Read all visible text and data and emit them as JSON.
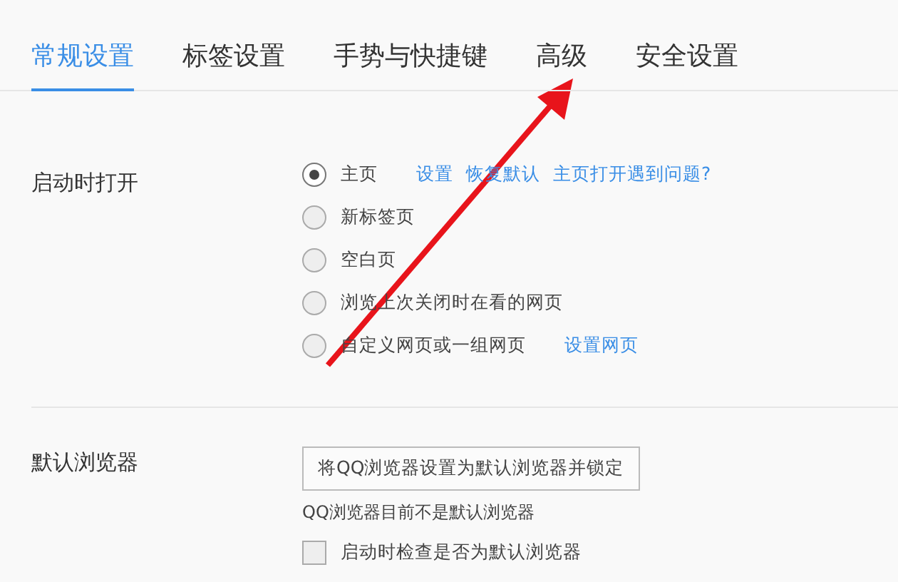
{
  "tabs": [
    {
      "label": "常规设置",
      "selected": true
    },
    {
      "label": "标签设置",
      "selected": false
    },
    {
      "label": "手势与快捷键",
      "selected": false
    },
    {
      "label": "高级",
      "selected": false
    },
    {
      "label": "安全设置",
      "selected": false
    }
  ],
  "startup": {
    "label": "启动时打开",
    "options": [
      {
        "label": "主页",
        "selected": true,
        "links": [
          "设置",
          "恢复默认",
          "主页打开遇到问题?"
        ]
      },
      {
        "label": "新标签页",
        "selected": false
      },
      {
        "label": "空白页",
        "selected": false
      },
      {
        "label": "浏览上次关闭时在看的网页",
        "selected": false
      },
      {
        "label": "自定义网页或一组网页",
        "selected": false,
        "links": [
          "设置网页"
        ]
      }
    ]
  },
  "default_browser": {
    "label": "默认浏览器",
    "button": "将QQ浏览器设置为默认浏览器并锁定",
    "status": "QQ浏览器目前不是默认浏览器",
    "check": {
      "label": "启动时检查是否为默认浏览器",
      "checked": false
    }
  },
  "annotation": {
    "kind": "arrow"
  }
}
